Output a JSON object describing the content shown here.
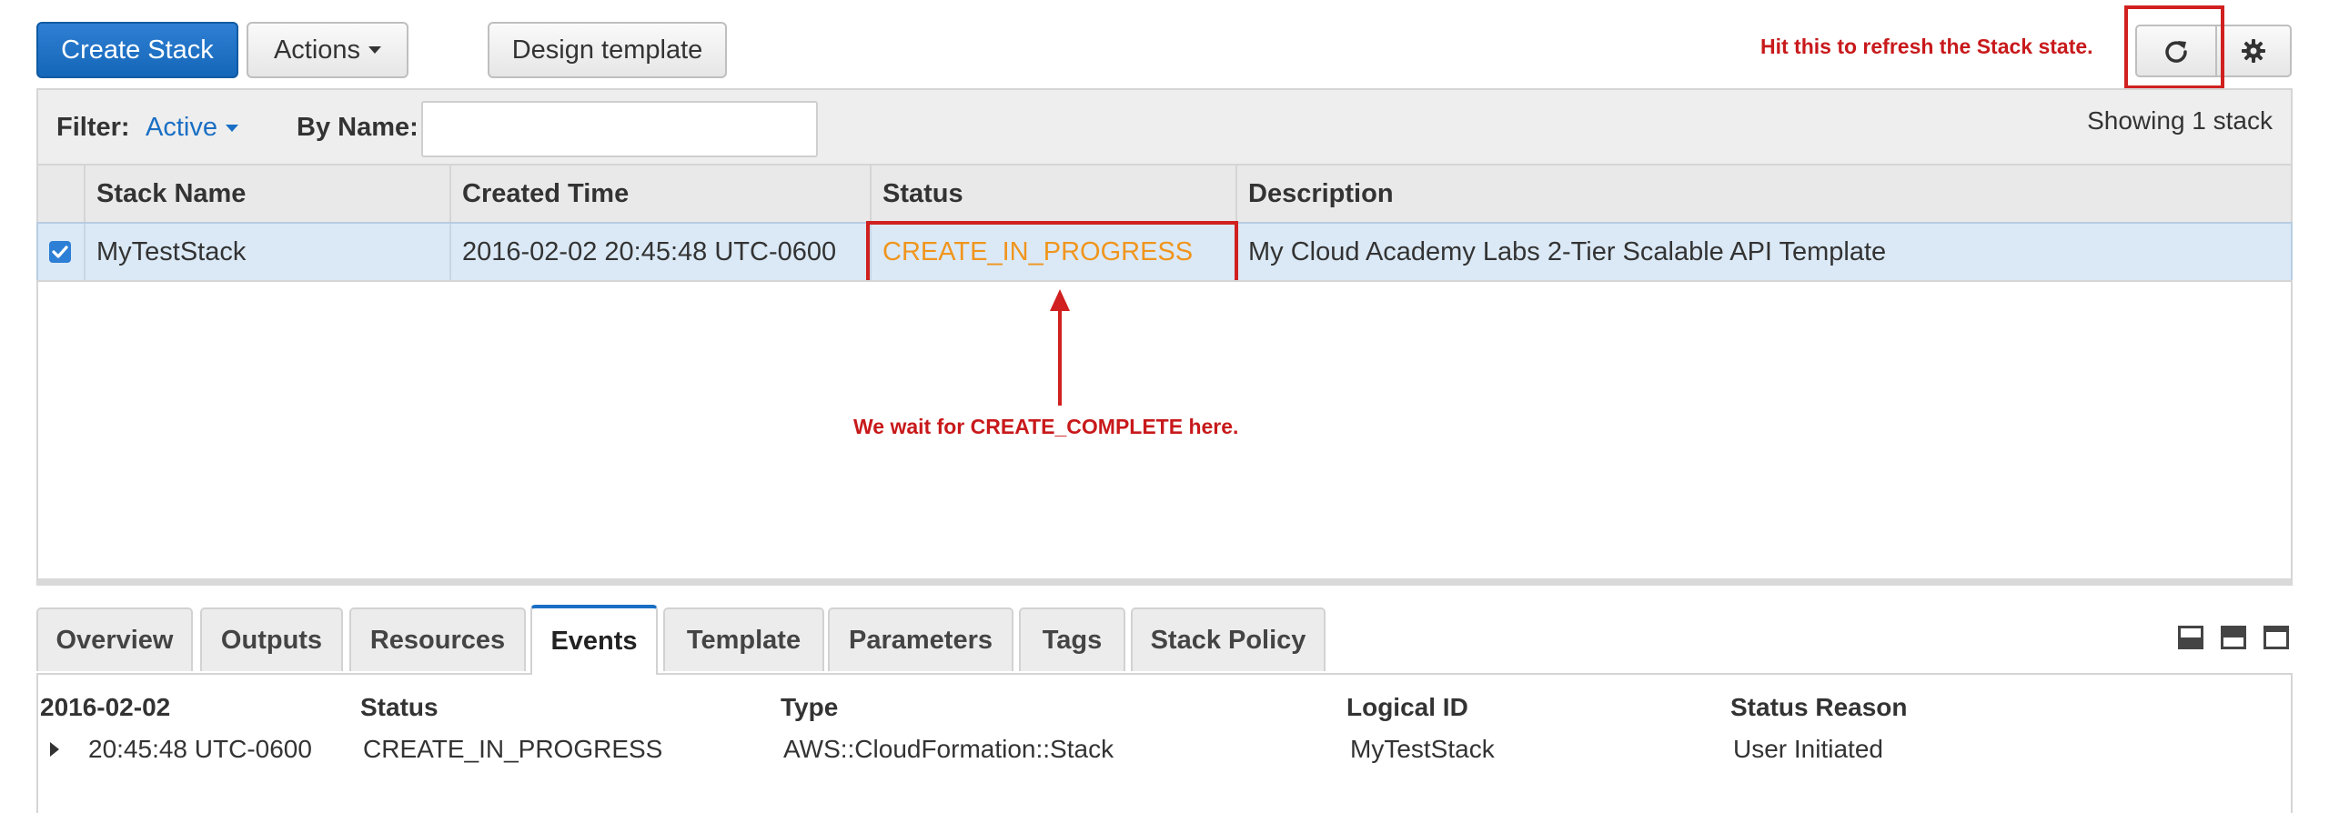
{
  "toolbar": {
    "create_stack_label": "Create Stack",
    "actions_label": "Actions",
    "design_template_label": "Design template",
    "refresh_icon": "refresh-icon",
    "settings_icon": "gear-icon"
  },
  "annotations": {
    "refresh_note": "Hit this to refresh the Stack state.",
    "status_note": "We wait for CREATE_COMPLETE here.",
    "highlight_color": "#d0201f"
  },
  "filter": {
    "label": "Filter:",
    "value": "Active",
    "by_name_label": "By Name:",
    "by_name_value": "",
    "showing_text": "Showing 1 stack"
  },
  "table": {
    "columns": [
      "Stack Name",
      "Created Time",
      "Status",
      "Description"
    ],
    "rows": [
      {
        "selected": true,
        "stack_name": "MyTestStack",
        "created_time": "2016-02-02 20:45:48 UTC-0600",
        "status": "CREATE_IN_PROGRESS",
        "description": "My Cloud Academy Labs 2-Tier Scalable API Template"
      }
    ]
  },
  "tabs": [
    {
      "label": "Overview",
      "active": false
    },
    {
      "label": "Outputs",
      "active": false
    },
    {
      "label": "Resources",
      "active": false
    },
    {
      "label": "Events",
      "active": true
    },
    {
      "label": "Template",
      "active": false
    },
    {
      "label": "Parameters",
      "active": false
    },
    {
      "label": "Tags",
      "active": false
    },
    {
      "label": "Stack Policy",
      "active": false
    }
  ],
  "events": {
    "date_header": "2016-02-02",
    "columns": [
      "Status",
      "Type",
      "Logical ID",
      "Status Reason"
    ],
    "rows": [
      {
        "time": "20:45:48 UTC-0600",
        "status": "CREATE_IN_PROGRESS",
        "type": "AWS::CloudFormation::Stack",
        "logical_id": "MyTestStack",
        "status_reason": "User Initiated"
      }
    ]
  },
  "colors": {
    "primary": "#1466b8",
    "status_in_progress": "#f0951d",
    "active_tab": "#1a6fc4",
    "selected_row": "#dbe9f6"
  }
}
